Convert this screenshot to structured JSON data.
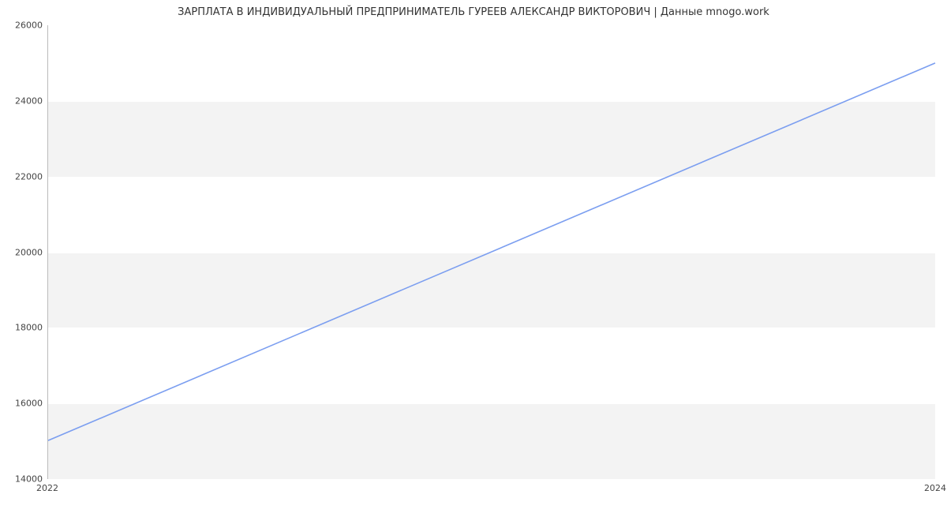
{
  "chart_data": {
    "type": "line",
    "title": "ЗАРПЛАТА В ИНДИВИДУАЛЬНЫЙ ПРЕДПРИНИМАТЕЛЬ ГУРЕЕВ АЛЕКСАНДР ВИКТОРОВИЧ | Данные mnogo.work",
    "xlabel": "",
    "ylabel": "",
    "x": [
      2022,
      2024
    ],
    "values": [
      15000,
      25000
    ],
    "x_ticks": [
      2022,
      2024
    ],
    "y_ticks": [
      14000,
      16000,
      18000,
      20000,
      22000,
      24000,
      26000
    ],
    "xlim": [
      2022,
      2024
    ],
    "ylim": [
      14000,
      26000
    ],
    "grid": true,
    "line_color": "#7b9ef0"
  }
}
